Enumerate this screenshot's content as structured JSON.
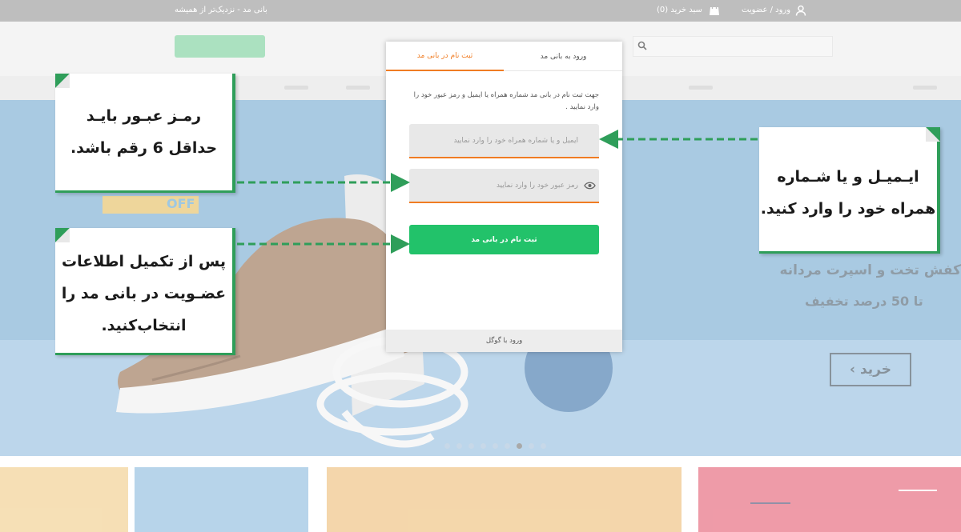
{
  "topbar": {
    "tagline": "بانی مد - نزدیک‌تر از همیشه",
    "login_label": "ورود / عضویت",
    "cart_label": "سبد خرید (0)"
  },
  "hero": {
    "headline": "کفش تخت و اسپرت مردانه",
    "subline": "تا 50 درصد تخفیف",
    "buy_label": "خرید",
    "off_label": "OFF"
  },
  "modal": {
    "tab_login": "ورود به بانی مد",
    "tab_signup": "ثبت نام در بانی مد",
    "description": "جهت ثبت نام در بانی مد شماره همراه یا ایمیل و رمز عبور خود را وارد نمایید .",
    "email_placeholder": "ایمیل و یا شماره همراه خود را وارد نمایید",
    "password_placeholder": "رمز عبور خود را وارد نمایید",
    "signup_button": "ثبت نام در بانی مد",
    "google_login": "ورود با گوگل"
  },
  "callouts": {
    "password_rule": [
      "رمـز عبـور بایـد",
      "حداقل 6 رقم باشد."
    ],
    "after_fill": [
      "پس از تکمیل اطلاعات",
      "عضـویت در بانی مد را",
      "انتخاب‌کنید."
    ],
    "email_phone": [
      "ایـمیـل و یا شـماره",
      "همراه خود را وارد کنید."
    ]
  },
  "colors": {
    "accent_orange": "#f07c23",
    "primary_green": "#22c26a",
    "callout_green": "#2f9e5a"
  }
}
